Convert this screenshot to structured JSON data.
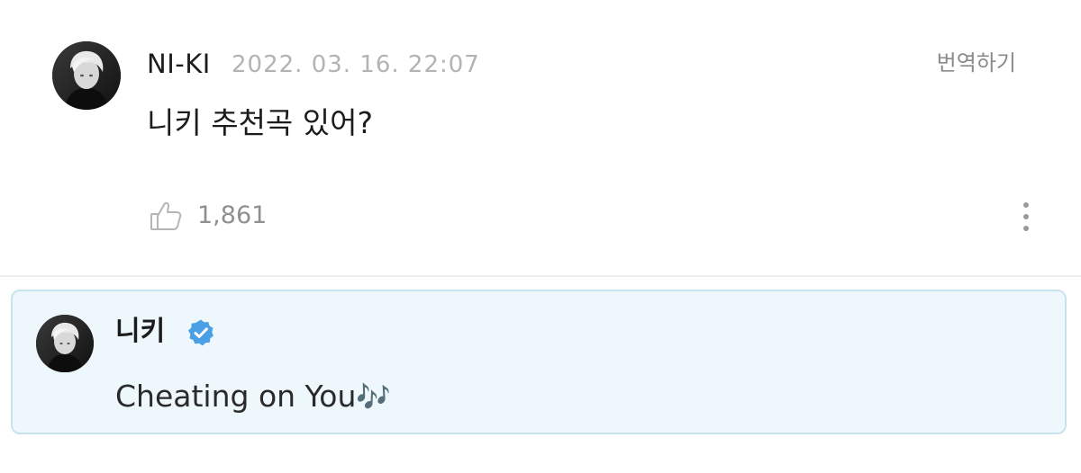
{
  "post": {
    "author": "NI-KI",
    "date": "2022. 03. 16. 22:07",
    "translate_label": "번역하기",
    "body": "니키 추천곡 있어?",
    "like_count": "1,861",
    "like_icon": "thumbs-up-icon",
    "more_icon": "more-vertical-icon"
  },
  "reply": {
    "author": "니키",
    "verified_icon": "verified-badge-icon",
    "body": "Cheating on You",
    "emoji": "🎶"
  },
  "colors": {
    "reply_background": "#edf7fc",
    "reply_border": "#c9e3ee",
    "verified_blue": "#4a9fe6",
    "muted_text": "#b3b3b3"
  }
}
